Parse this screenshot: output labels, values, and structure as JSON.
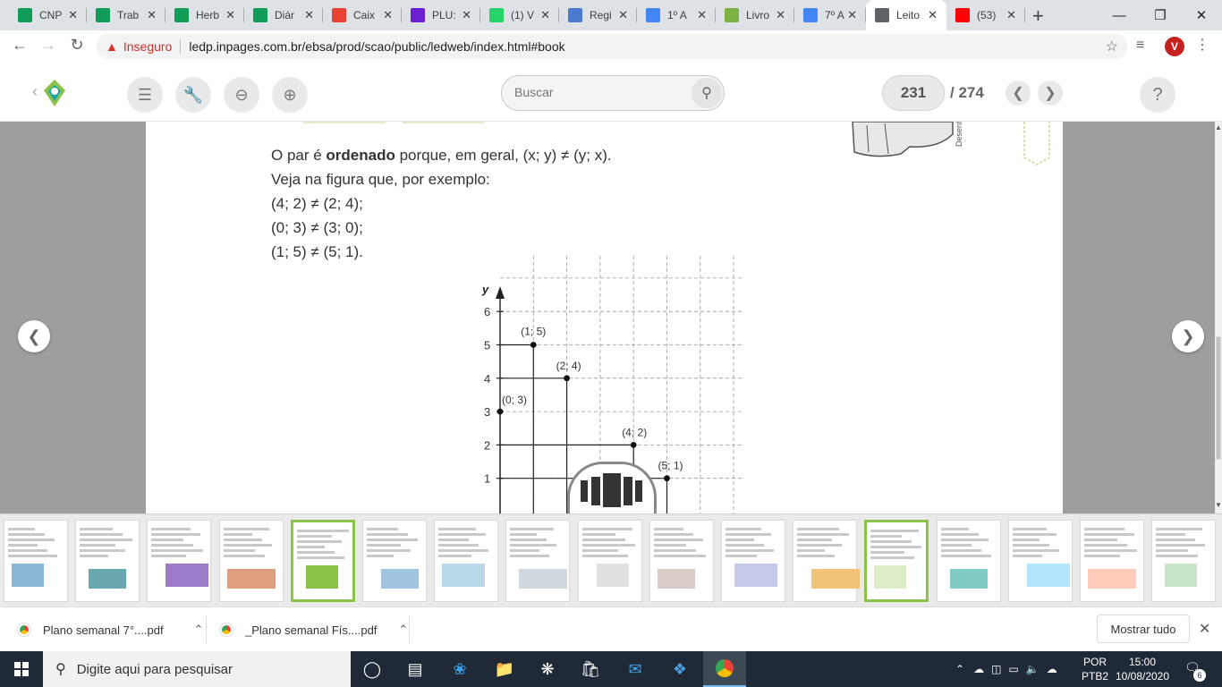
{
  "tabs": [
    {
      "title": "CNP",
      "icon": "sheets-icon",
      "color": "#0f9d58"
    },
    {
      "title": "Trab",
      "icon": "sheets-icon",
      "color": "#0f9d58"
    },
    {
      "title": "Herb",
      "icon": "sheets-icon",
      "color": "#0f9d58"
    },
    {
      "title": "Diár",
      "icon": "sheets-icon",
      "color": "#0f9d58"
    },
    {
      "title": "Caix",
      "icon": "gmail-icon",
      "color": "#ea4335"
    },
    {
      "title": "PLU:",
      "icon": "plurall-icon",
      "color": "#6a1fd1"
    },
    {
      "title": "(1) V",
      "icon": "whatsapp-icon",
      "color": "#25d366"
    },
    {
      "title": "Regi",
      "icon": "shield-icon",
      "color": "#4a7bd0"
    },
    {
      "title": "1º A",
      "icon": "docs-icon",
      "color": "#4285f4"
    },
    {
      "title": "Livro",
      "icon": "ledweb-icon",
      "color": "#7cb342"
    },
    {
      "title": "7º A",
      "icon": "docs-icon",
      "color": "#4285f4"
    },
    {
      "title": "Leito",
      "icon": "globe-icon",
      "color": "#5f6368",
      "active": true
    },
    {
      "title": "(53)",
      "icon": "youtube-icon",
      "color": "#ff0000"
    }
  ],
  "address": {
    "security": "Inseguro",
    "url": "ledp.inpages.com.br/ebsa/prod/scao/public/ledweb/index.html#book"
  },
  "profile_initial": "V",
  "reader": {
    "search_placeholder": "Buscar",
    "current_page": "231",
    "total_pages": "/ 274",
    "help": "?"
  },
  "page_text": {
    "line1_prefix": "O par é ",
    "line1_bold": "ordenado",
    "line1_suffix": " porque, em geral, (x; y) ≠ (y; x).",
    "line2": "Veja na figura que, por exemplo:",
    "line3": "(4; 2) ≠ (2; 4);",
    "line4": "(0; 3) ≠ (3; 0);",
    "line5": "(1; 5) ≠ (5; 1)."
  },
  "chart_data": {
    "type": "scatter",
    "ylabel": "y",
    "y_ticks": [
      "1",
      "2",
      "3",
      "4",
      "5",
      "6"
    ],
    "points": [
      {
        "x": 1,
        "y": 5,
        "label": "(1; 5)"
      },
      {
        "x": 2,
        "y": 4,
        "label": "(2; 4)"
      },
      {
        "x": 0,
        "y": 3,
        "label": "(0; 3)"
      },
      {
        "x": 4,
        "y": 2,
        "label": "(4; 2)"
      },
      {
        "x": 5,
        "y": 1,
        "label": "(5; 1)"
      }
    ],
    "grid": true,
    "xlim": [
      0,
      7
    ],
    "ylim": [
      0,
      7
    ]
  },
  "page_side_label": "Desenh",
  "thumbnails_count": 17,
  "selected_thumbnails": [
    4,
    12
  ],
  "downloads": [
    {
      "name": "Plano semanal 7°....pdf"
    },
    {
      "name": "_Plano semanal Fís....pdf"
    }
  ],
  "downloads_show_all": "Mostrar tudo",
  "taskbar": {
    "search_placeholder": "Digite aqui para pesquisar",
    "lang_line1": "POR",
    "lang_line2": "PTB2",
    "time": "15:00",
    "date": "10/08/2020",
    "notifications": "6"
  }
}
